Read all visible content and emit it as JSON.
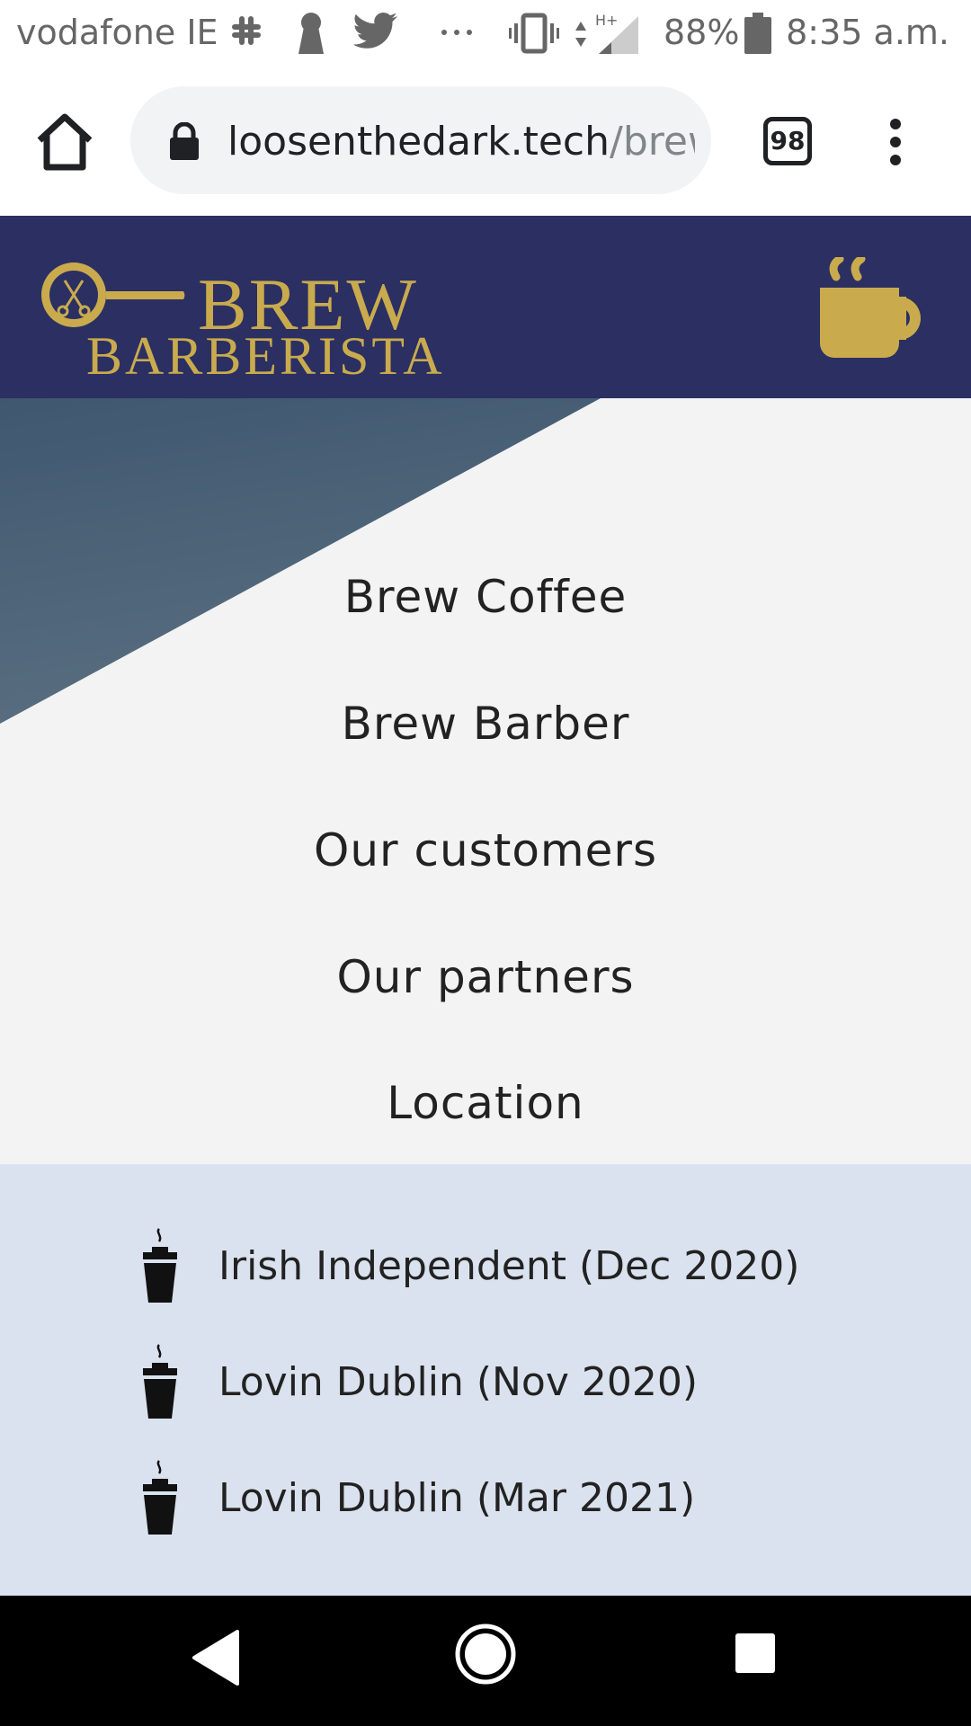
{
  "status_bar": {
    "carrier": "vodafone IE",
    "battery": "88%",
    "time": "8:35 a.m.",
    "icons": [
      "slack-icon",
      "keyhole-icon",
      "twitter-icon",
      "more-notifications-icon",
      "vibrate-icon",
      "network-h-plus-icon",
      "signal-icon",
      "battery-icon"
    ],
    "network_label": "H+"
  },
  "browser": {
    "url_host": "loosenthedark.tech",
    "url_path": "/brew",
    "tab_count": "98",
    "icons": [
      "home-icon",
      "lock-icon",
      "tabs-icon",
      "overflow-menu-icon"
    ]
  },
  "header": {
    "logo_line1": "BREW",
    "logo_line2": "BARBERISTA",
    "menu_icon": "coffee-cup-icon",
    "brand_color": "#2b2f62",
    "accent_color": "#c9ab4e"
  },
  "nav": {
    "items": [
      {
        "label": "Brew Coffee"
      },
      {
        "label": "Brew Barber"
      },
      {
        "label": "Our customers"
      },
      {
        "label": "Our partners"
      },
      {
        "label": "Location"
      }
    ]
  },
  "press": {
    "icon": "takeaway-coffee-icon",
    "items": [
      {
        "label": "Irish Independent (Dec 2020)"
      },
      {
        "label": "Lovin Dublin (Nov 2020)"
      },
      {
        "label": "Lovin Dublin (Mar 2021)"
      }
    ]
  },
  "system_nav": {
    "icons": [
      "back-icon",
      "home-circle-icon",
      "recents-icon"
    ]
  }
}
